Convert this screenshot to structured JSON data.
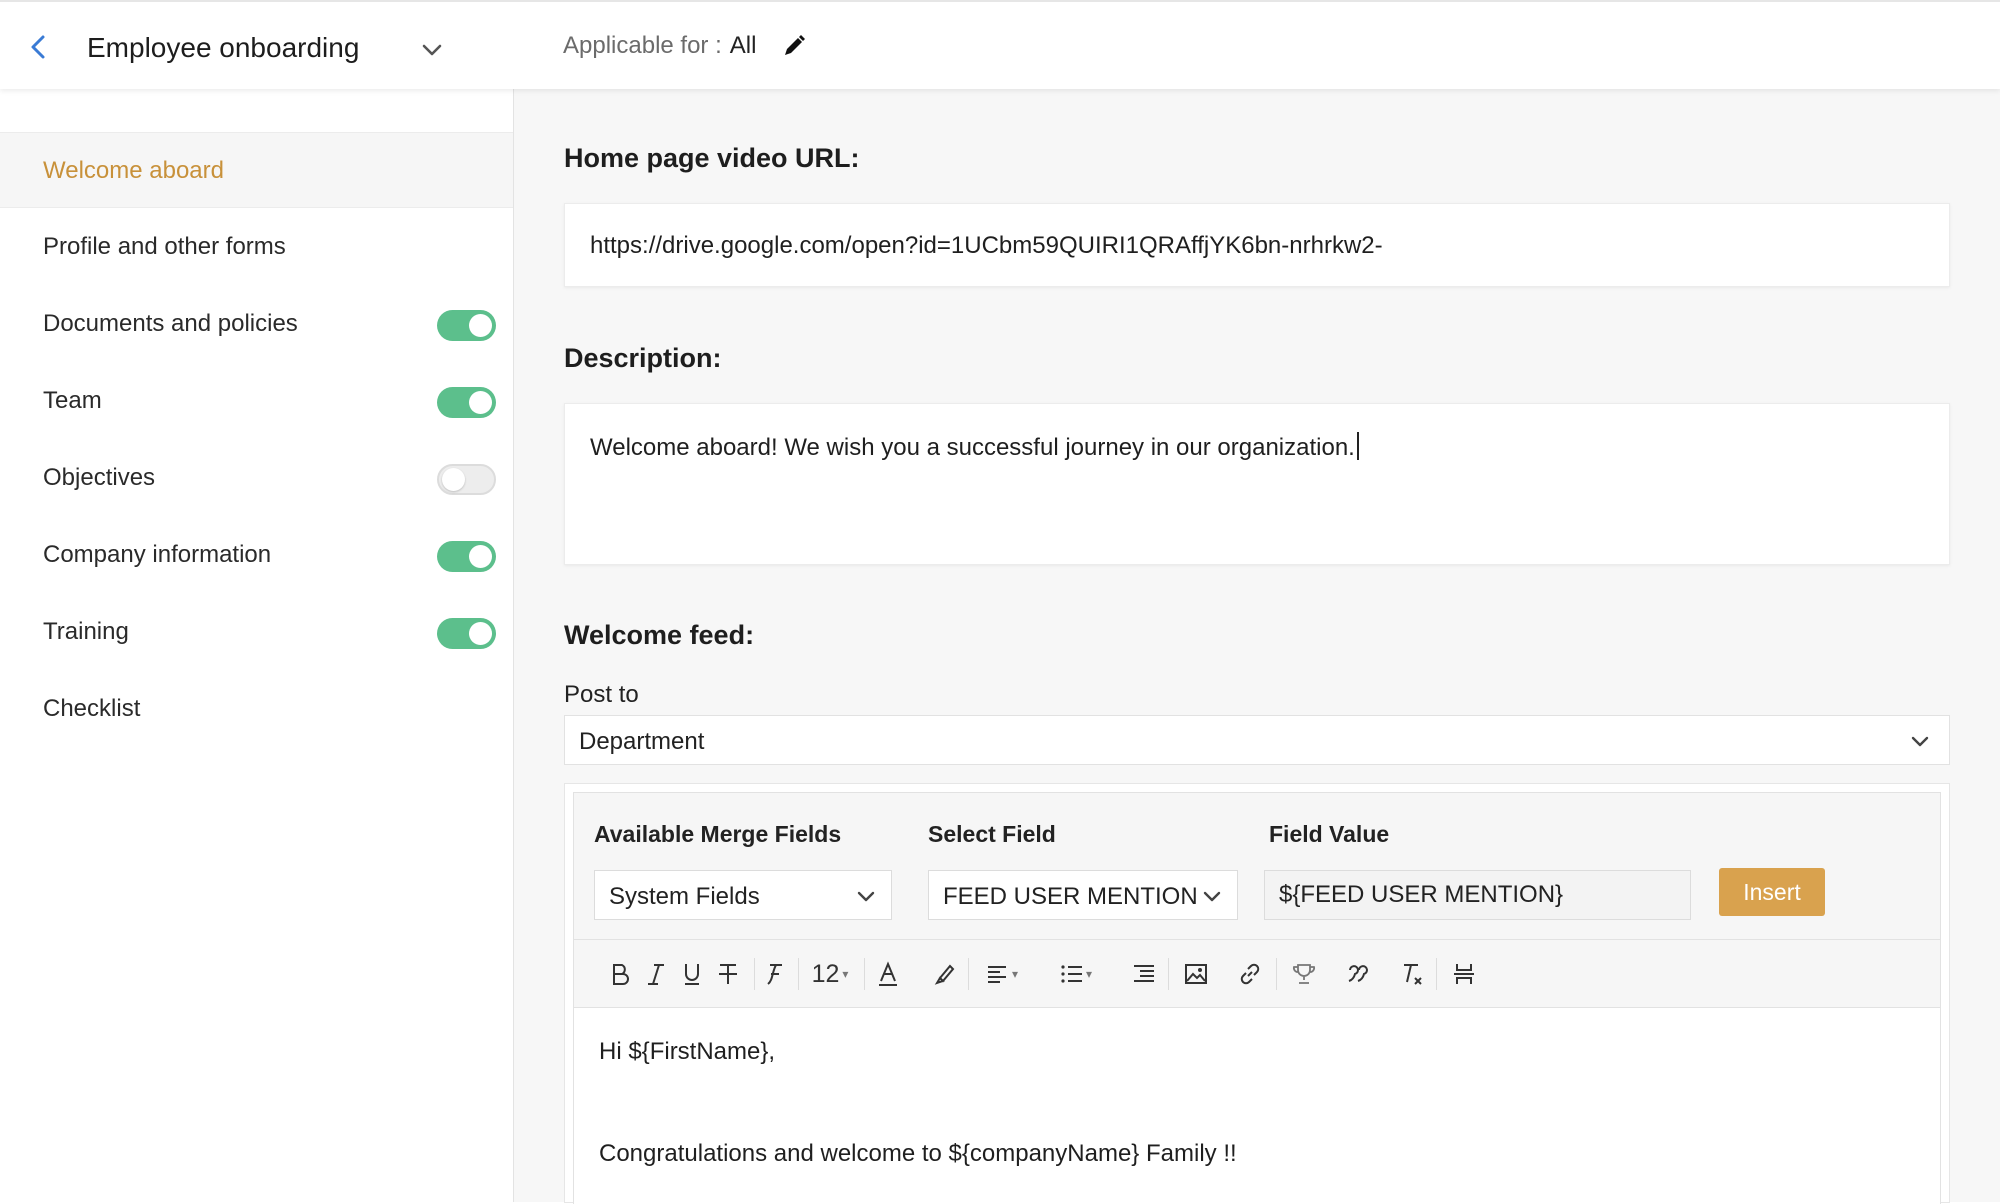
{
  "header": {
    "title": "Employee onboarding",
    "applicable_label": "Applicable for :",
    "applicable_value": "All"
  },
  "sidebar": {
    "items": [
      {
        "label": "Welcome aboard",
        "active": true,
        "toggle": null
      },
      {
        "label": "Profile and other forms",
        "active": false,
        "toggle": null
      },
      {
        "label": "Documents and policies",
        "active": false,
        "toggle": "on"
      },
      {
        "label": "Team",
        "active": false,
        "toggle": "on"
      },
      {
        "label": "Objectives",
        "active": false,
        "toggle": "off"
      },
      {
        "label": "Company information",
        "active": false,
        "toggle": "on"
      },
      {
        "label": "Training",
        "active": false,
        "toggle": "on"
      },
      {
        "label": "Checklist",
        "active": false,
        "toggle": null
      }
    ]
  },
  "main": {
    "video_label": "Home page video URL:",
    "video_url": "https://drive.google.com/open?id=1UCbm59QUIRI1QRAffjYK6bn-nrhrkw2-",
    "description_label": "Description:",
    "description": "Welcome aboard! We wish you a successful journey in our organization.",
    "feed_label": "Welcome feed:",
    "post_to_label": "Post to",
    "post_to_value": "Department"
  },
  "merge": {
    "available_label": "Available Merge Fields",
    "select_label": "Select Field",
    "value_label": "Field Value",
    "available_value": "System Fields",
    "select_value": "FEED USER MENTION",
    "field_value": "${FEED USER MENTION}",
    "insert_label": "Insert"
  },
  "toolbar": {
    "font_size": "12",
    "tools": [
      "bold-icon",
      "italic-icon",
      "underline-icon",
      "strikethrough-icon",
      "font-family-icon",
      "font-size-select",
      "font-color-icon",
      "highlight-icon",
      "align-icon",
      "list-icon",
      "indent-icon",
      "image-icon",
      "link-icon",
      "award-icon",
      "quote-icon",
      "clear-format-icon",
      "page-break-icon"
    ]
  },
  "editor": {
    "line1": "Hi ${FirstName},",
    "line2": "Congratulations and welcome to ${companyName} Family !!"
  },
  "colors": {
    "accent": "#c8913a",
    "toggle_on": "#5cbf8c",
    "insert_button": "#d9a24e",
    "back_arrow": "#3a7bd5"
  }
}
